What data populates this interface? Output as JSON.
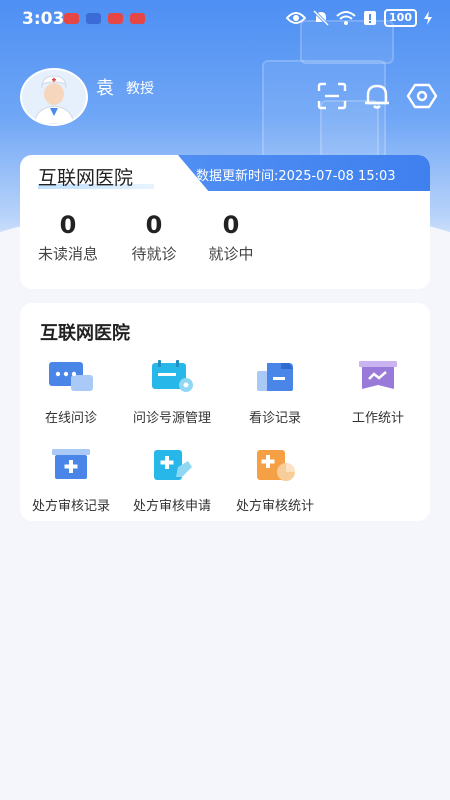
{
  "status_bar": {
    "time": "3:03",
    "battery": "100"
  },
  "header": {
    "name": "袁",
    "title": "教授"
  },
  "hospital_card": {
    "tab_title": "互联网医院",
    "update_label": "数据更新时间:2025-07-08 15:03",
    "stats": [
      {
        "value": "0",
        "label": "未读消息"
      },
      {
        "value": "0",
        "label": "待就诊"
      },
      {
        "value": "0",
        "label": "就诊中"
      }
    ]
  },
  "services": {
    "title": "互联网医院",
    "items": [
      {
        "label": "在线问诊",
        "icon": "chat-icon"
      },
      {
        "label": "问诊号源管理",
        "icon": "schedule-settings-icon"
      },
      {
        "label": "看诊记录",
        "icon": "record-folder-icon"
      },
      {
        "label": "工作统计",
        "icon": "statistics-icon"
      },
      {
        "label": "处方审核记录",
        "icon": "prescription-record-icon"
      },
      {
        "label": "处方审核申请",
        "icon": "prescription-apply-icon"
      },
      {
        "label": "处方审核统计",
        "icon": "prescription-stats-icon"
      }
    ]
  },
  "colors": {
    "primary": "#3f80ef",
    "hero_top": "#4d8ff3",
    "orange": "#f5a044",
    "purple": "#9a7ad8",
    "cyan": "#27b7e8"
  }
}
